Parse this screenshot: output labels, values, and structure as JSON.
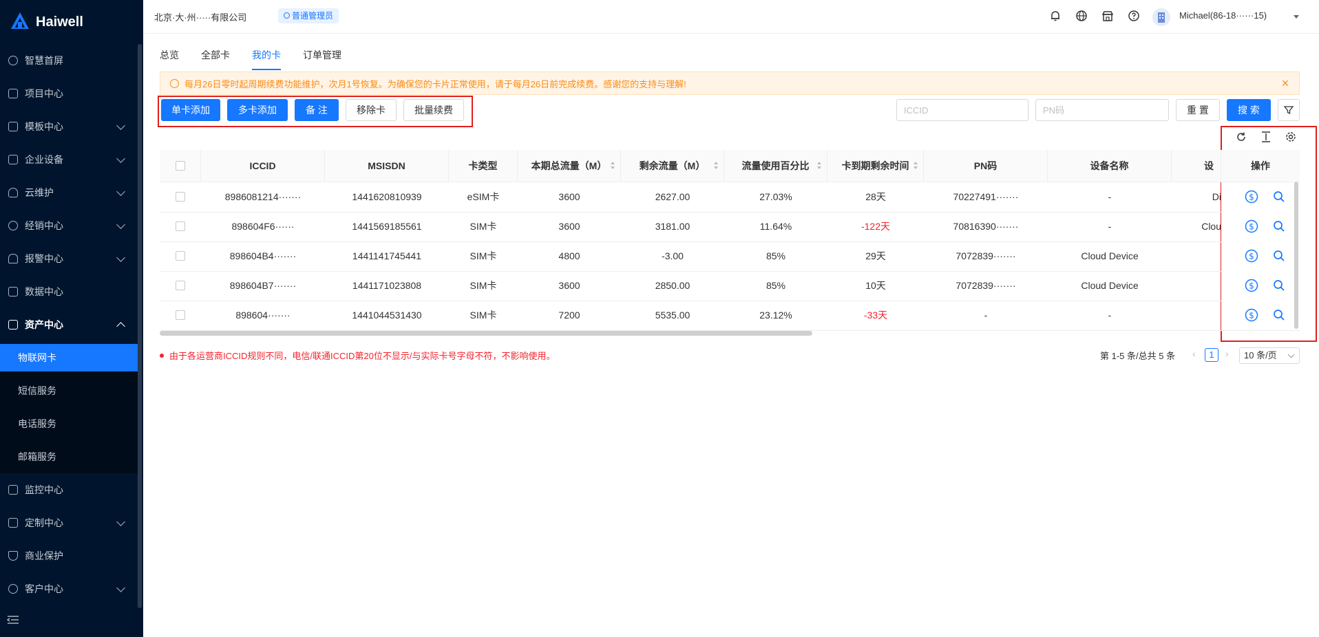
{
  "brand": {
    "name": "Haiwell",
    "sub": "Haiwell"
  },
  "sidebar": {
    "items": [
      {
        "label": "智慧首屏",
        "icon": "globe-icon",
        "has_children": false
      },
      {
        "label": "项目中心",
        "icon": "list-icon",
        "has_children": false
      },
      {
        "label": "模板中心",
        "icon": "template-icon",
        "has_children": true
      },
      {
        "label": "企业设备",
        "icon": "monitor-icon",
        "has_children": true
      },
      {
        "label": "云维护",
        "icon": "cloud-icon",
        "has_children": true
      },
      {
        "label": "经销中心",
        "icon": "dealer-icon",
        "has_children": true
      },
      {
        "label": "报警中心",
        "icon": "alarm-icon",
        "has_children": true
      },
      {
        "label": "数据中心",
        "icon": "database-icon",
        "has_children": false
      },
      {
        "label": "资产中心",
        "icon": "asset-icon",
        "has_children": true,
        "expanded": true
      },
      {
        "label": "监控中心",
        "icon": "camera-icon",
        "has_children": false
      },
      {
        "label": "定制中心",
        "icon": "custom-icon",
        "has_children": true
      },
      {
        "label": "商业保护",
        "icon": "shield-icon",
        "has_children": false
      },
      {
        "label": "客户中心",
        "icon": "customer-icon",
        "has_children": true
      }
    ],
    "sub_items": [
      {
        "label": "物联网卡",
        "active": true
      },
      {
        "label": "短信服务",
        "active": false
      },
      {
        "label": "电话服务",
        "active": false
      },
      {
        "label": "邮箱服务",
        "active": false
      }
    ]
  },
  "header": {
    "company": "北京·大·州·····有限公司",
    "role": "普通管理员",
    "username": "Michael(86-18······15)"
  },
  "tabs": [
    {
      "label": "总览",
      "active": false
    },
    {
      "label": "全部卡",
      "active": false
    },
    {
      "label": "我的卡",
      "active": true
    },
    {
      "label": "订单管理",
      "active": false
    }
  ],
  "alert": {
    "text": "每月26日零时起周期续费功能维护，次月1号恢复。为确保您的卡片正常使用，请于每月26日前完成续费。感谢您的支持与理解!",
    "close": "×"
  },
  "toolbar": {
    "single_add": "单卡添加",
    "multi_add": "多卡添加",
    "remark": "备 注",
    "remove": "移除卡",
    "batch_renew": "批量续费",
    "iccid_placeholder": "ICCID",
    "pn_placeholder": "PN码",
    "reset": "重 置",
    "search": "搜 索"
  },
  "table": {
    "columns": [
      "ICCID",
      "MSISDN",
      "卡类型",
      "本期总流量（M）",
      "剩余流量（M）",
      "流量使用百分比",
      "卡到期剩余时间",
      "PN码",
      "设备名称",
      "设",
      "操作"
    ],
    "rows": [
      {
        "iccid": "8986081214·······",
        "msisdn": "1441620810939",
        "type": "eSIM卡",
        "total": "3600",
        "remain": "2627.00",
        "percent": "27.03%",
        "expire": "28天",
        "expire_red": false,
        "pn": "70227491·······",
        "device": "-",
        "extra": "Di"
      },
      {
        "iccid": "898604F6······",
        "msisdn": "1441569185561",
        "type": "SIM卡",
        "total": "3600",
        "remain": "3181.00",
        "percent": "11.64%",
        "expire": "-122天",
        "expire_red": true,
        "pn": "70816390·······",
        "device": "-",
        "extra": "Clou"
      },
      {
        "iccid": "898604B4·······",
        "msisdn": "1441141745441",
        "type": "SIM卡",
        "total": "4800",
        "remain": "-3.00",
        "percent": "85%",
        "expire": "29天",
        "expire_red": false,
        "pn": "7072839·······",
        "device": "Cloud Device",
        "extra": ""
      },
      {
        "iccid": "898604B7·······",
        "msisdn": "1441171023808",
        "type": "SIM卡",
        "total": "3600",
        "remain": "2850.00",
        "percent": "85%",
        "expire": "10天",
        "expire_red": false,
        "pn": "7072839·······",
        "device": "Cloud Device",
        "extra": ""
      },
      {
        "iccid": "898604·······",
        "msisdn": "1441044531430",
        "type": "SIM卡",
        "total": "7200",
        "remain": "5535.00",
        "percent": "23.12%",
        "expire": "-33天",
        "expire_red": true,
        "pn": "-",
        "device": "-",
        "extra": ""
      }
    ]
  },
  "footer": {
    "note": "由于各运营商ICCID规则不同，电信/联通ICCID第20位不显示/与实际卡号字母不符，不影响使用。",
    "summary": "第 1-5 条/总共 5 条",
    "page": "1",
    "page_size": "10 条/页"
  },
  "colors": {
    "primary": "#1677ff",
    "sidebar_bg": "#00152d",
    "warning": "#fa8c16",
    "danger": "#f5222d",
    "highlight_box": "#e11d1d"
  }
}
